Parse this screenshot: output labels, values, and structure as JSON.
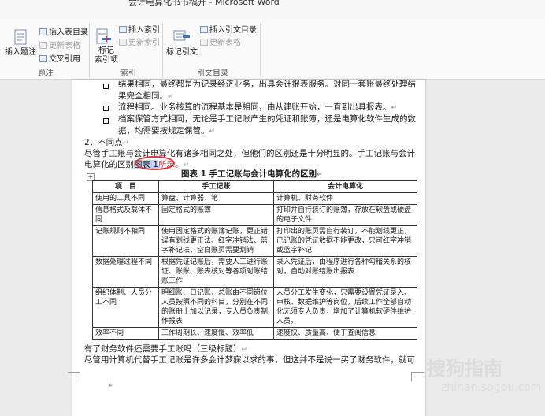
{
  "window": {
    "title": "会计电算化书书稿开 - Microsoft Word"
  },
  "ribbon": {
    "insert_caption": "插入题注",
    "insert_table_of_figures": "插入表目录",
    "update_table": "更新表格",
    "cross_reference": "交叉引用",
    "group_captions": "题注",
    "mark_entry": "标记\n索引项",
    "insert_index": "插入索引",
    "update_index": "更新索引",
    "group_index": "索引",
    "mark_citation": "标记引文",
    "insert_table_of_authorities": "插入引文目录",
    "update_table_authorities": "更新表格",
    "group_citations": "引文目录"
  },
  "document": {
    "bullets": [
      {
        "line1": "结果相同，最终都是为记录经济业务，出具会计报表服务。对同一套账最终处理结",
        "line2": "果完全相同。"
      },
      {
        "line1": "流程相同。业务核算的流程基本是相同，由从建账开始，一直到出具报表。",
        "line2": ""
      },
      {
        "line1": "档案保管方式相同，无论是手工记账产生的凭证和账簿，还是电算化软件生成的数",
        "line2": "据，均需要按规定保管。"
      }
    ],
    "section_heading": "2．不同点",
    "intro_line1": "尽管手工账与会计电算化有诸多相同之处，但他们的区别还是十分明显的。手工记账与会计",
    "intro_line2_prefix": "电算化的区别",
    "intro_ref": "图表 1",
    "intro_suffix": "所示。",
    "table_caption": "图表 1 手工记账与会计电算化的区别",
    "table": {
      "headers": [
        "项　目",
        "手工记账",
        "会计电算化"
      ],
      "rows": [
        [
          "使用的工具不同",
          "算盘、计算器、笔",
          "计算机、财务软件"
        ],
        [
          "信息格式及载体不同",
          "固定格式的账簿",
          "打印并自行装订的账簿，存放在软盘或硬盘的电子文件"
        ],
        [
          "记账规则不相同",
          "使用固定格式的账簿记账，更正错误有划线更正法、红字冲销法、蓝字补记法，空白账页需要划销",
          "打印出的账页需自行装订，不能划线更正，已记账的凭证数据不能更改，只可红字冲销或蓝字补记"
        ],
        [
          "数据处理过程不同",
          "根据凭证记账后，需要人工进行账证、账账、账表核对等各项对账结账工作",
          "录入凭证后，由程序进行各种勾稽关系的核对，自动对账结账出报表"
        ],
        [
          "组织体制、人员分工不同",
          "明细账、日记账、总账由不同岗位人员按照不同的科目，分别在不同的账册上加以记录，专人员负责制作报表",
          "人员分工发生变化，只需要设置凭证录入、审核、数据维护等岗位，后续工作全部自动化无须专人负责，增加了计算机软硬件维护人员。"
        ],
        [
          "效率不同",
          "工作周期长、速度慢、效率低",
          "速度快、质量高、便于查阅信息"
        ]
      ]
    },
    "after_table_heading": "有了财务软件还需要手工账吗（三级标题）",
    "last_para": "尽管用计算机代替手工记账是许多会计梦寐以求的事，但这并不是说一买了财务软件，就可",
    "para_mark": "↵"
  },
  "watermark": {
    "brand": "搜狗指南",
    "url": "zhinan.sogou.com"
  }
}
